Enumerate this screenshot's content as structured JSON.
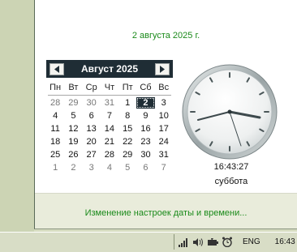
{
  "header": {
    "date_text": "2 августа 2025 г."
  },
  "calendar": {
    "month_title": "Август 2025",
    "weekdays": [
      "Пн",
      "Вт",
      "Ср",
      "Чт",
      "Пт",
      "Сб",
      "Вс"
    ],
    "weeks": [
      [
        "28",
        "29",
        "30",
        "31",
        "1",
        "2",
        "3"
      ],
      [
        "4",
        "5",
        "6",
        "7",
        "8",
        "9",
        "10"
      ],
      [
        "11",
        "12",
        "13",
        "14",
        "15",
        "16",
        "17"
      ],
      [
        "18",
        "19",
        "20",
        "21",
        "22",
        "23",
        "24"
      ],
      [
        "25",
        "26",
        "27",
        "28",
        "29",
        "30",
        "31"
      ],
      [
        "1",
        "2",
        "3",
        "4",
        "5",
        "6",
        "7"
      ]
    ]
  },
  "clock": {
    "time": "16:43:27",
    "day_name": "суббота"
  },
  "footer": {
    "link_text": "Изменение настроек даты и времени..."
  },
  "taskbar": {
    "language": "ENG",
    "time": "16:43"
  },
  "colors": {
    "accent_green": "#1a8a1a",
    "calendar_header": "#1f2d35"
  }
}
